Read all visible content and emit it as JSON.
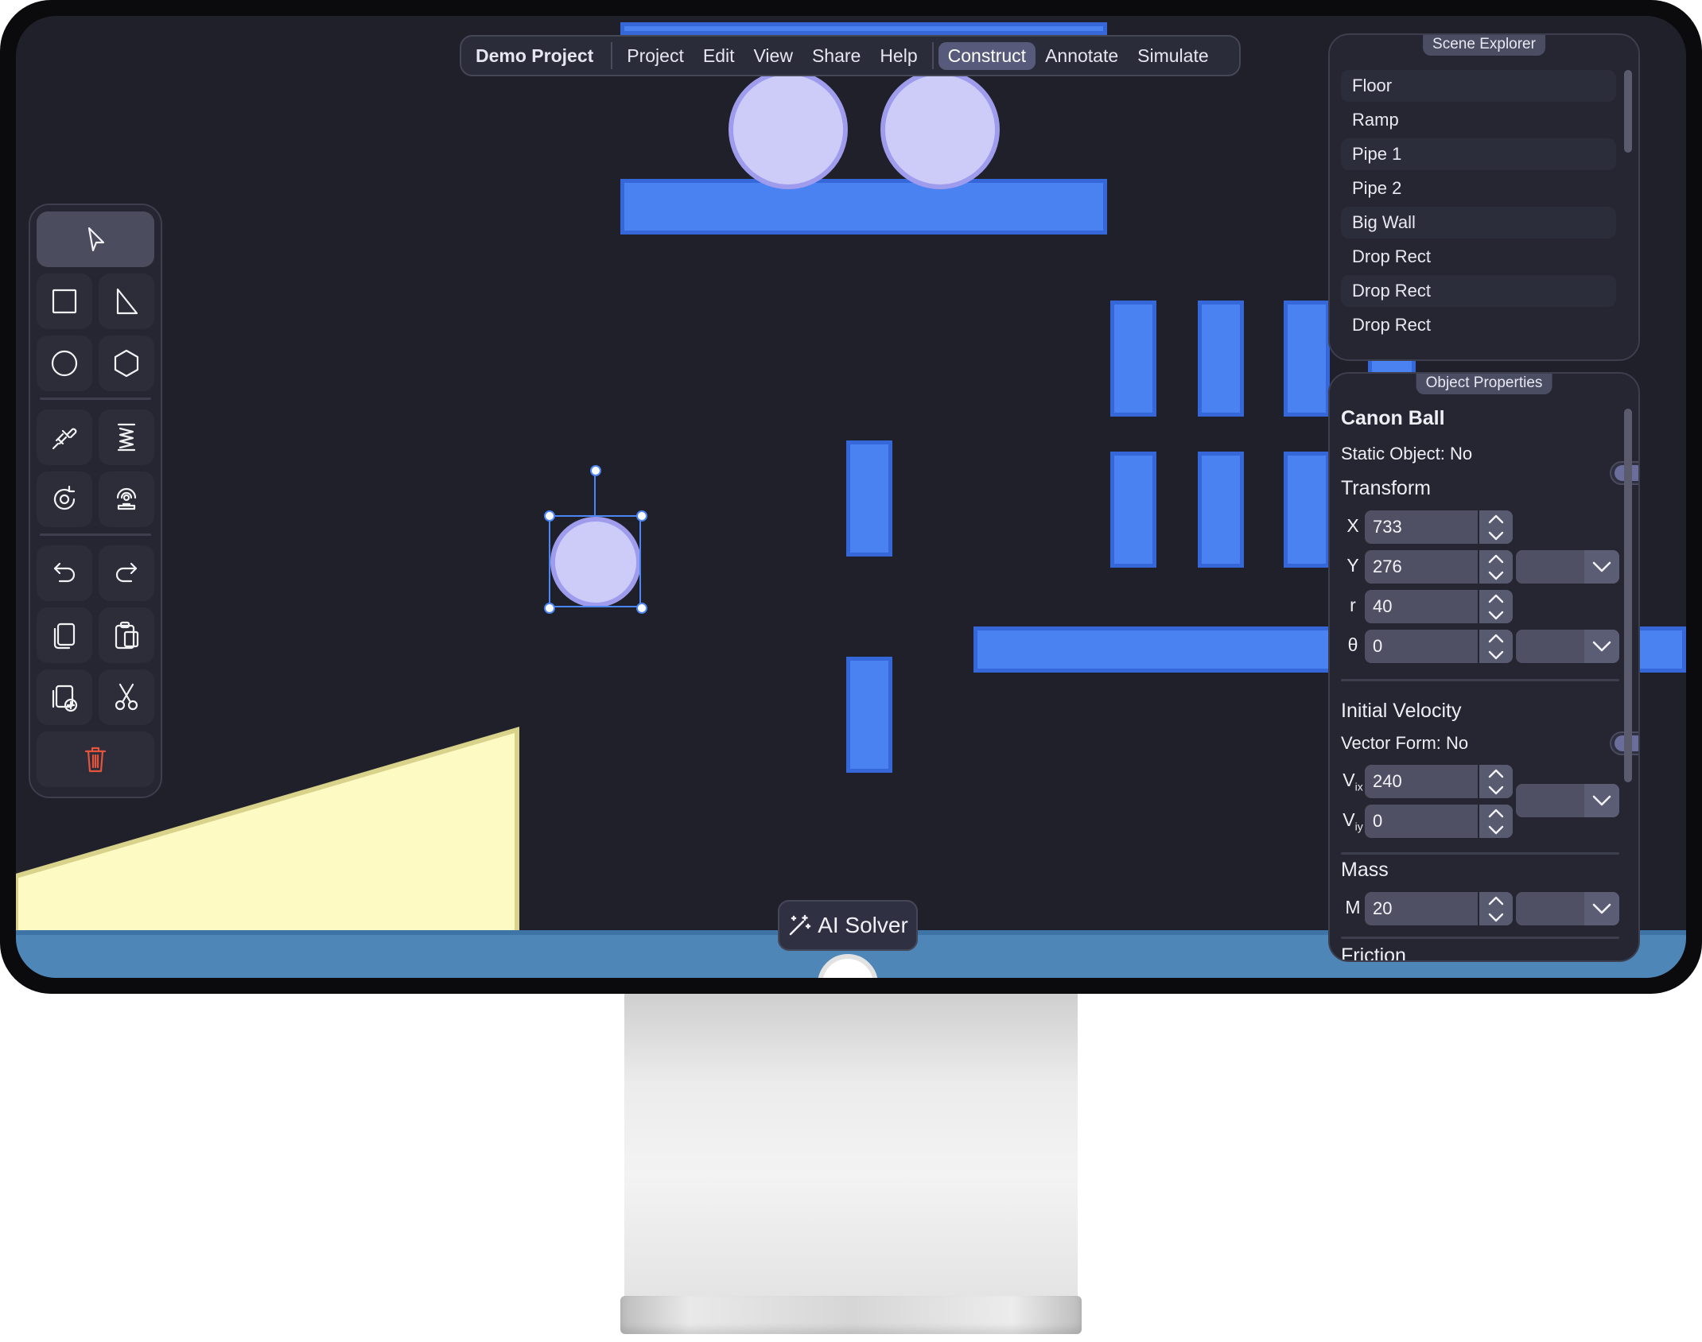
{
  "menu": {
    "project_title": "Demo Project",
    "items": [
      "Project",
      "Edit",
      "View",
      "Share",
      "Help"
    ],
    "modes": [
      "Construct",
      "Annotate",
      "Simulate"
    ],
    "active_mode": "Construct"
  },
  "toolbar": {
    "tools": [
      "select-tool",
      "rectangle-tool",
      "triangle-tool",
      "circle-tool",
      "polygon-tool",
      "rope-tool",
      "spring-tool",
      "rotation-tool",
      "sensor-tool",
      "undo",
      "redo",
      "copy",
      "paste",
      "duplicate",
      "cut",
      "delete"
    ],
    "selected_tool": "select-tool"
  },
  "ai_solver": {
    "label": "AI Solver"
  },
  "scene_explorer": {
    "title": "Scene Explorer",
    "items": [
      "Floor",
      "Ramp",
      "Pipe 1",
      "Pipe 2",
      "Big Wall",
      "Drop Rect",
      "Drop Rect",
      "Drop Rect"
    ]
  },
  "object_properties": {
    "title": "Object Properties",
    "object_name": "Canon Ball",
    "static_label": "Static Object: No",
    "transform_label": "Transform",
    "x": {
      "label": "X",
      "value": "733"
    },
    "y": {
      "label": "Y",
      "value": "276"
    },
    "r": {
      "label": "r",
      "value": "40"
    },
    "theta": {
      "label": "θ",
      "value": "0"
    },
    "velocity_label": "Initial Velocity",
    "vector_form_label": "Vector Form: No",
    "vix": {
      "label": "V",
      "sub": "ix",
      "value": "240"
    },
    "viy": {
      "label": "V",
      "sub": "iy",
      "value": "0"
    },
    "mass_label": "Mass",
    "mass": {
      "label": "M",
      "value": "20"
    },
    "friction_label": "Friction"
  },
  "colors": {
    "canvas": "#1f2029",
    "block": "#4a82f1",
    "ball": "#cdccf9",
    "ramp": "#fdfac3",
    "floor": "#4f86b8",
    "accent": "#575a7a"
  }
}
